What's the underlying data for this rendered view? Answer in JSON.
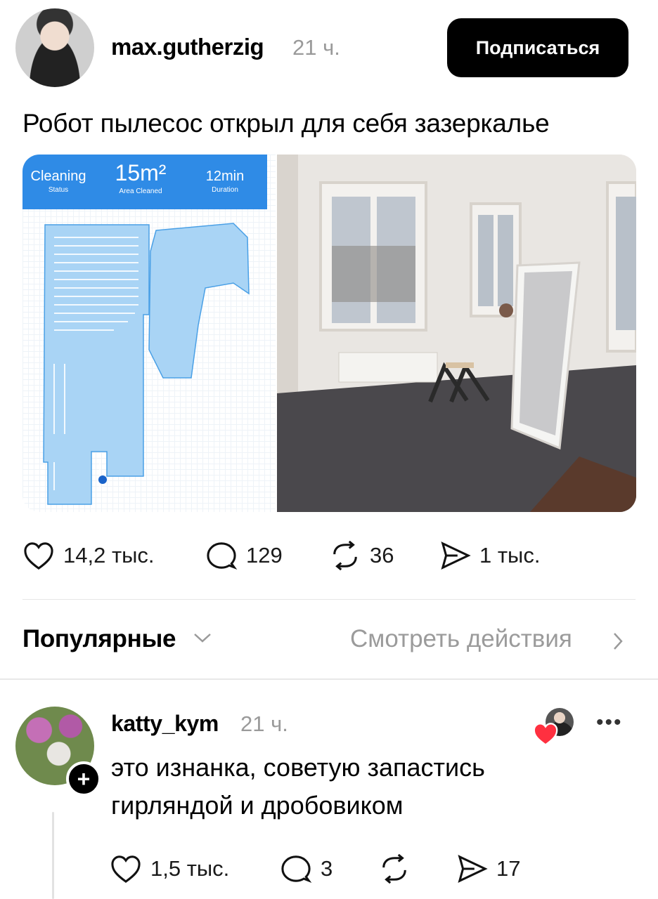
{
  "post": {
    "username": "max.gutherzig",
    "time": "21 ч.",
    "follow_label": "Подписаться",
    "text": "Робот пылесос открыл для себя зазеркалье",
    "media": {
      "app_stats": [
        {
          "value": "Cleaning",
          "caption": "Status"
        },
        {
          "value": "15m²",
          "caption": "Area Cleaned"
        },
        {
          "value": "12min",
          "caption": "Duration"
        }
      ]
    },
    "actions": {
      "likes": "14,2 тыс.",
      "comments": "129",
      "reposts": "36",
      "shares": "1 тыс."
    }
  },
  "sort": {
    "label": "Популярные",
    "view_activity": "Смотреть действия"
  },
  "comment": {
    "username": "katty_kym",
    "time": "21 ч.",
    "text_line1": "это изнанка, советую запастись",
    "text_line2": "гирляндой и дробовиком",
    "plus": "+",
    "more": "•••",
    "actions": {
      "likes": "1,5 тыс.",
      "comments": "3",
      "reposts": "",
      "shares": "17"
    }
  },
  "colors": {
    "accent": "#000000",
    "muted": "#9a9a9a",
    "app_blue": "#2f8be6",
    "map_fill": "#a9d4f5",
    "heart_red": "#ff3040"
  },
  "icons": [
    "heart-icon",
    "comment-icon",
    "repost-icon",
    "share-icon",
    "chevron-down-icon",
    "chevron-right-icon",
    "more-icon"
  ]
}
